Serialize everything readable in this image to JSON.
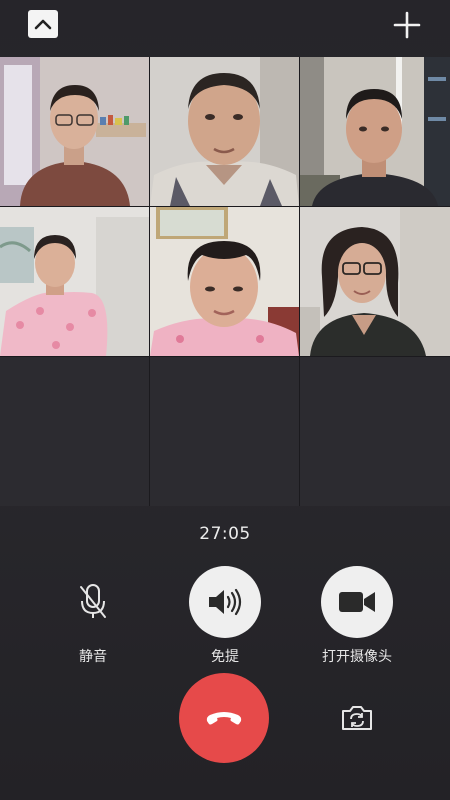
{
  "call": {
    "timer": "27:05"
  },
  "controls": {
    "mute_label": "静音",
    "speaker_label": "免提",
    "camera_label": "打开摄像头"
  },
  "icons": {
    "collapse": "chevron-up-icon",
    "add": "plus-icon",
    "mute": "microphone-off-icon",
    "speaker": "speaker-icon",
    "camera": "video-camera-icon",
    "hangup": "phone-hangup-icon",
    "flip": "camera-switch-icon"
  },
  "colors": {
    "background": "#26252a",
    "hangup": "#e64a4a",
    "button_light": "#efefef",
    "text": "#e6e6e6"
  },
  "participants": [
    {
      "video": "on"
    },
    {
      "video": "on"
    },
    {
      "video": "on"
    },
    {
      "video": "on"
    },
    {
      "video": "on"
    },
    {
      "video": "on"
    }
  ]
}
